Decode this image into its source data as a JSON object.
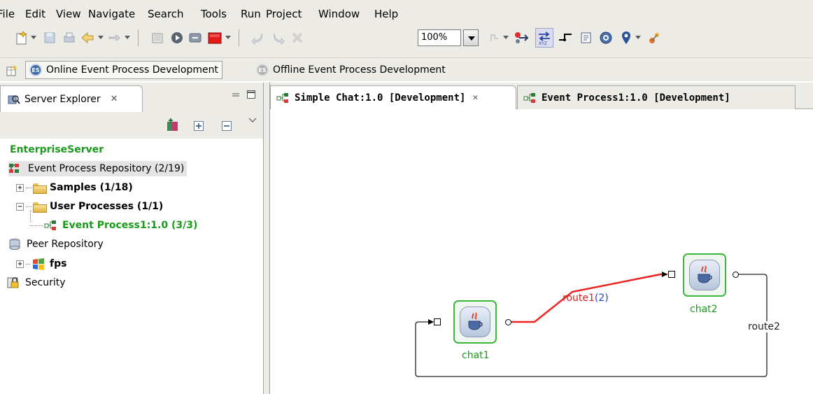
{
  "menubar": {
    "items": [
      "File",
      "Edit",
      "View",
      "Navigate",
      "Search",
      "Tools",
      "Run",
      "Project",
      "Window",
      "Help"
    ]
  },
  "toolbar": {
    "zoom_value": "100%"
  },
  "perspectives": {
    "online": "Online Event Process Development",
    "offline": "Offline Event Process Development"
  },
  "server_explorer": {
    "tab_label": "Server Explorer",
    "server_name": "EnterpriseServer",
    "tree": {
      "event_repo": "Event Process Repository (2/19)",
      "samples": "Samples (1/18)",
      "user_processes": "User Processes (1/1)",
      "event_process": "Event Process1:1.0 (3/3)",
      "peer_repo": "Peer Repository",
      "fps": "fps",
      "security": "Security"
    }
  },
  "editor": {
    "tabs": [
      "Simple Chat:1.0 [Development]",
      "Event Process1:1.0 [Development]"
    ],
    "nodes": {
      "chat1": "chat1",
      "chat2": "chat2"
    },
    "routes": {
      "route1_label": "route1",
      "route1_count": "(2)",
      "route2_label": "route2"
    }
  },
  "colors": {
    "chrome": "#ecebe6",
    "node_border": "#3cb83c",
    "route_active": "#ee2222",
    "green_text": "#1a9a1a"
  }
}
